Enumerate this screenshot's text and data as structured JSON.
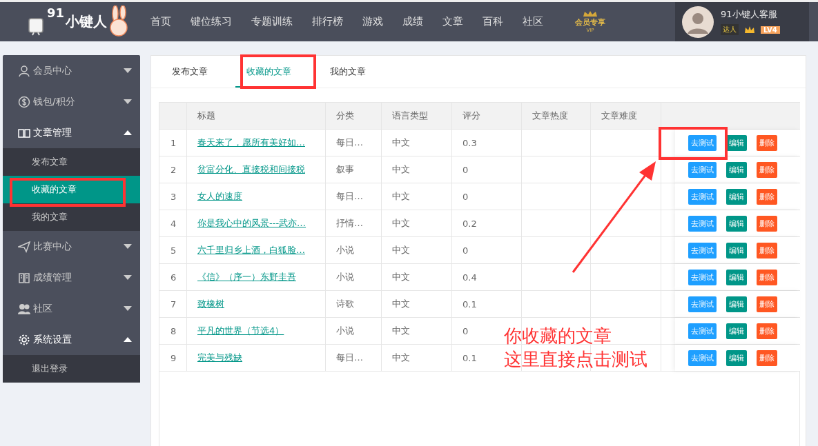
{
  "header": {
    "logo": {
      "digits": "91",
      "name": "小键人"
    },
    "nav": [
      {
        "label": "首页",
        "selected": false
      },
      {
        "label": "键位练习",
        "selected": false
      },
      {
        "label": "专题训练",
        "selected": false
      },
      {
        "label": "排行榜",
        "selected": false
      },
      {
        "label": "游戏",
        "selected": false
      },
      {
        "label": "成绩",
        "selected": false
      },
      {
        "label": "文章",
        "selected": false
      },
      {
        "label": "百科",
        "selected": false
      },
      {
        "label": "社区",
        "selected": false
      }
    ],
    "vip_badge": {
      "title": "会员专享",
      "sub": "VIP"
    },
    "user": {
      "name": "91小键人客服",
      "title_badge": "达人",
      "level": "LV4"
    }
  },
  "sidebar": {
    "items": [
      {
        "label": "会员中心",
        "expanded": false
      },
      {
        "label": "钱包/积分",
        "expanded": false
      },
      {
        "label": "文章管理",
        "expanded": true,
        "children": [
          {
            "label": "发布文章",
            "selected": false
          },
          {
            "label": "收藏的文章",
            "selected": true
          },
          {
            "label": "我的文章",
            "selected": false
          }
        ]
      },
      {
        "label": "比赛中心",
        "expanded": false
      },
      {
        "label": "成绩管理",
        "expanded": false
      },
      {
        "label": "社区",
        "expanded": false
      },
      {
        "label": "系统设置",
        "expanded": true,
        "children": [
          {
            "label": "退出登录",
            "selected": false
          }
        ]
      }
    ]
  },
  "tabs": [
    {
      "label": "发布文章",
      "selected": false
    },
    {
      "label": "收藏的文章",
      "selected": true
    },
    {
      "label": "我的文章",
      "selected": false
    }
  ],
  "table": {
    "columns": [
      "标题",
      "分类",
      "语言类型",
      "评分",
      "文章热度",
      "文章难度"
    ],
    "rows": [
      {
        "index": "1",
        "title": "春天来了，愿所有美好如…",
        "category": "每日…",
        "language": "中文",
        "score": "0.3",
        "actions": [
          {
            "label": "去测试",
            "kind": "test"
          },
          {
            "label": "编辑",
            "kind": "edit"
          },
          {
            "label": "删除",
            "kind": "delete"
          }
        ]
      },
      {
        "index": "2",
        "title": "贫富分化、直接税和间接税",
        "category": "叙事",
        "language": "中文",
        "score": "0",
        "actions": [
          {
            "label": "去测试",
            "kind": "test"
          },
          {
            "label": "编辑",
            "kind": "edit"
          },
          {
            "label": "删除",
            "kind": "delete"
          }
        ]
      },
      {
        "index": "3",
        "title": "女人的速度",
        "category": "每日…",
        "language": "中文",
        "score": "0",
        "actions": [
          {
            "label": "去测试",
            "kind": "test"
          },
          {
            "label": "编辑",
            "kind": "edit"
          },
          {
            "label": "删除",
            "kind": "delete"
          }
        ]
      },
      {
        "index": "4",
        "title": "你是我心中的风景---武亦…",
        "category": "抒情…",
        "language": "中文",
        "score": "0.2",
        "actions": [
          {
            "label": "去测试",
            "kind": "test"
          },
          {
            "label": "编辑",
            "kind": "edit"
          },
          {
            "label": "删除",
            "kind": "delete"
          }
        ]
      },
      {
        "index": "5",
        "title": "六千里归乡上酒，白狐脸…",
        "category": "小说",
        "language": "中文",
        "score": "0",
        "actions": [
          {
            "label": "去测试",
            "kind": "test"
          },
          {
            "label": "编辑",
            "kind": "edit"
          },
          {
            "label": "删除",
            "kind": "delete"
          }
        ]
      },
      {
        "index": "6",
        "title": "《信》（序一）东野圭吾",
        "category": "小说",
        "language": "中文",
        "score": "0.4",
        "actions": [
          {
            "label": "去测试",
            "kind": "test"
          },
          {
            "label": "编辑",
            "kind": "edit"
          },
          {
            "label": "删除",
            "kind": "delete"
          }
        ]
      },
      {
        "index": "7",
        "title": "致橡树",
        "category": "诗歌",
        "language": "中文",
        "score": "0.1",
        "actions": [
          {
            "label": "去测试",
            "kind": "test"
          },
          {
            "label": "编辑",
            "kind": "edit"
          },
          {
            "label": "删除",
            "kind": "delete"
          }
        ]
      },
      {
        "index": "8",
        "title": "平凡的世界（节选4）",
        "category": "小说",
        "language": "中文",
        "score": "0",
        "actions": [
          {
            "label": "去测试",
            "kind": "test"
          },
          {
            "label": "编辑",
            "kind": "edit"
          },
          {
            "label": "删除",
            "kind": "delete"
          }
        ]
      },
      {
        "index": "9",
        "title": "完美与残缺",
        "category": "每日…",
        "language": "中文",
        "score": "0.1",
        "actions": [
          {
            "label": "去测试",
            "kind": "test"
          },
          {
            "label": "编辑",
            "kind": "edit"
          },
          {
            "label": "删除",
            "kind": "delete"
          }
        ]
      }
    ]
  },
  "annotation": {
    "lines": [
      "你收藏的文章",
      "这里直接点击测试"
    ]
  }
}
